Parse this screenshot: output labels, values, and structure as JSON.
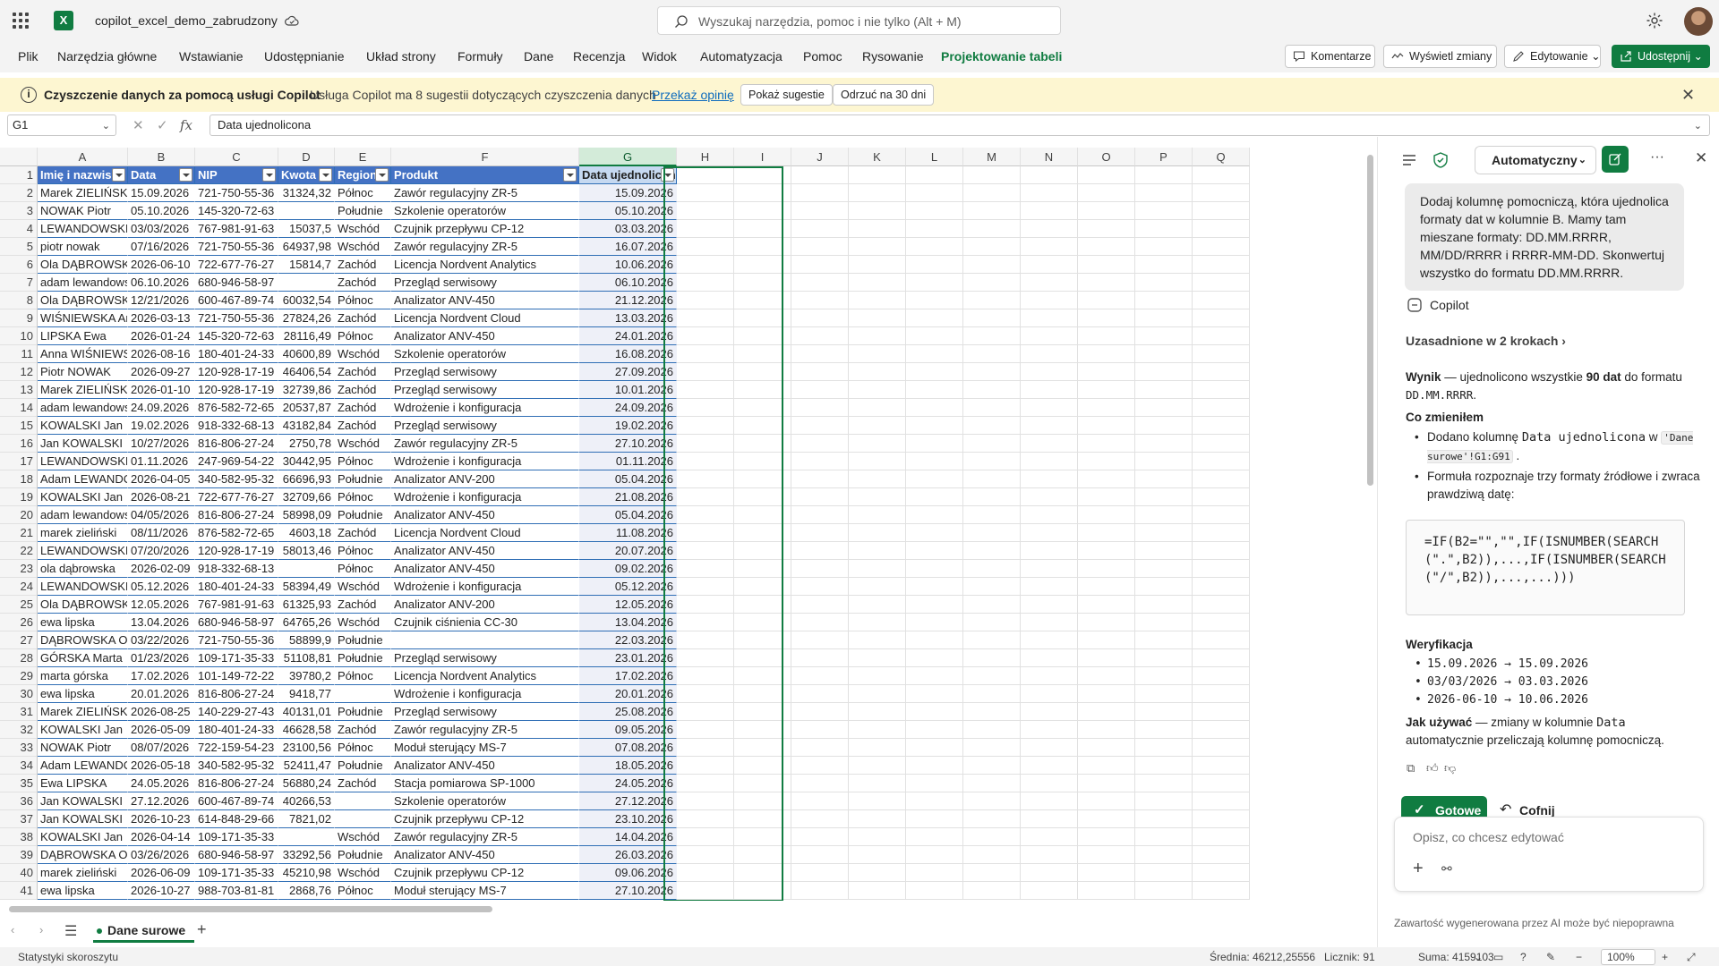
{
  "app": {
    "doc_title": "copilot_excel_demo_zabrudzony",
    "search_placeholder": "Wyszukaj narzędzia, pomoc i nie tylko (Alt + M)",
    "logo": "X"
  },
  "ribbon": {
    "tabs": [
      "Plik",
      "Narzędzia główne",
      "Wstawianie",
      "Udostępnianie",
      "Układ strony",
      "Formuły",
      "Dane",
      "Recenzja",
      "Widok",
      "Automatyzacja",
      "Pomoc",
      "Rysowanie",
      "Projektowanie tabeli"
    ],
    "active_tab": "Projektowanie tabeli",
    "comments": "Komentarze",
    "show_changes": "Wyświetl zmiany",
    "editing": "Edytowanie",
    "share": "Udostępnij"
  },
  "banner": {
    "title": "Czyszczenie danych za pomocą usługi Copilot",
    "text": "Usługa Copilot ma 8 sugestii dotyczących czyszczenia danych",
    "link": "Przekaż opinię",
    "show_btn": "Pokaż sugestie",
    "dismiss_btn": "Odrzuć na 30 dni"
  },
  "formula_bar": {
    "name_box": "G1",
    "fx": "fx",
    "value": "Data ujednolicona"
  },
  "grid": {
    "columns": [
      "A",
      "B",
      "C",
      "D",
      "E",
      "F",
      "G",
      "H",
      "I",
      "J",
      "K",
      "L",
      "M",
      "N",
      "O",
      "P",
      "Q"
    ],
    "headers": [
      "Imię i nazwisko",
      "Data",
      "NIP",
      "Kwota",
      "Region",
      "Produkt",
      "Data ujednolicona"
    ],
    "rows": [
      [
        "Marek ZIELIŃSKI",
        "15.09.2026",
        "721-750-55-36",
        "31324,32",
        "Północ",
        "Zawór regulacyjny ZR-5",
        "15.09.2026"
      ],
      [
        "NOWAK Piotr",
        "05.10.2026",
        "145-320-72-63",
        "",
        "Południe",
        "Szkolenie operatorów",
        "05.10.2026"
      ],
      [
        "LEWANDOWSKI Adam",
        "03/03/2026",
        "767-981-91-63",
        "15037,5",
        "Wschód",
        "Czujnik przepływu CP-12",
        "03.03.2026"
      ],
      [
        "piotr nowak",
        "07/16/2026",
        "721-750-55-36",
        "64937,98",
        "Wschód",
        "Zawór regulacyjny ZR-5",
        "16.07.2026"
      ],
      [
        "Ola DĄBROWSKA",
        "2026-06-10",
        "722-677-76-27",
        "15814,7",
        "Zachód",
        "Licencja Nordvent Analytics",
        "10.06.2026"
      ],
      [
        "adam lewandowski",
        "06.10.2026",
        "680-946-58-97",
        "",
        "Zachód",
        "Przegląd serwisowy",
        "06.10.2026"
      ],
      [
        "Ola DĄBROWSKA",
        "12/21/2026",
        "600-467-89-74",
        "60032,54",
        "Północ",
        "Analizator ANV-450",
        "21.12.2026"
      ],
      [
        "WIŚNIEWSKA Anna",
        "2026-03-13",
        "721-750-55-36",
        "27824,26",
        "Zachód",
        "Licencja Nordvent Cloud",
        "13.03.2026"
      ],
      [
        "LIPSKA Ewa",
        "2026-01-24",
        "145-320-72-63",
        "28116,49",
        "Północ",
        "Analizator ANV-450",
        "24.01.2026"
      ],
      [
        "Anna WIŚNIEWSKA",
        "2026-08-16",
        "180-401-24-33",
        "40600,89",
        "Wschód",
        "Szkolenie operatorów",
        "16.08.2026"
      ],
      [
        "Piotr NOWAK",
        "2026-09-27",
        "120-928-17-19",
        "46406,54",
        "Zachód",
        "Przegląd serwisowy",
        "27.09.2026"
      ],
      [
        "Marek ZIELIŃSKI",
        "2026-01-10",
        "120-928-17-19",
        "32739,86",
        "Zachód",
        "Przegląd serwisowy",
        "10.01.2026"
      ],
      [
        "adam lewandowski",
        "24.09.2026",
        "876-582-72-65",
        "20537,87",
        "Zachód",
        "Wdrożenie i konfiguracja",
        "24.09.2026"
      ],
      [
        "KOWALSKI Jan",
        "19.02.2026",
        "918-332-68-13",
        "43182,84",
        "Zachód",
        "Przegląd serwisowy",
        "19.02.2026"
      ],
      [
        "Jan KOWALSKI",
        "10/27/2026",
        "816-806-27-24",
        "2750,78",
        "Wschód",
        "Zawór regulacyjny ZR-5",
        "27.10.2026"
      ],
      [
        "LEWANDOWSKI Adam",
        "01.11.2026",
        "247-969-54-22",
        "30442,95",
        "Północ",
        "Wdrożenie i konfiguracja",
        "01.11.2026"
      ],
      [
        "Adam LEWANDOWSKI",
        "2026-04-05",
        "340-582-95-32",
        "66696,93",
        "Południe",
        "Analizator ANV-200",
        "05.04.2026"
      ],
      [
        "KOWALSKI Jan",
        "2026-08-21",
        "722-677-76-27",
        "32709,66",
        "Północ",
        "Wdrożenie i konfiguracja",
        "21.08.2026"
      ],
      [
        "adam lewandowski",
        "04/05/2026",
        "816-806-27-24",
        "58998,09",
        "Południe",
        "Analizator ANV-450",
        "05.04.2026"
      ],
      [
        "marek zieliński",
        "08/11/2026",
        "876-582-72-65",
        "4603,18",
        "Zachód",
        "Licencja Nordvent Cloud",
        "11.08.2026"
      ],
      [
        "LEWANDOWSKI Adam",
        "07/20/2026",
        "120-928-17-19",
        "58013,46",
        "Północ",
        "Analizator ANV-450",
        "20.07.2026"
      ],
      [
        "ola dąbrowska",
        "2026-02-09",
        "918-332-68-13",
        "",
        "Północ",
        "Analizator ANV-450",
        "09.02.2026"
      ],
      [
        "LEWANDOWSKI Adam",
        "05.12.2026",
        "180-401-24-33",
        "58394,49",
        "Wschód",
        "Wdrożenie i konfiguracja",
        "05.12.2026"
      ],
      [
        "Ola DĄBROWSKA",
        "12.05.2026",
        "767-981-91-63",
        "61325,93",
        "Zachód",
        "Analizator ANV-200",
        "12.05.2026"
      ],
      [
        "ewa lipska",
        "13.04.2026",
        "680-946-58-97",
        "64765,26",
        "Wschód",
        "Czujnik ciśnienia CC-30",
        "13.04.2026"
      ],
      [
        "DĄBROWSKA Ola",
        "03/22/2026",
        "721-750-55-36",
        "58899,9",
        "Południe",
        "",
        "22.03.2026"
      ],
      [
        "GÓRSKA Marta",
        "01/23/2026",
        "109-171-35-33",
        "51108,81",
        "Południe",
        "Przegląd serwisowy",
        "23.01.2026"
      ],
      [
        "marta górska",
        "17.02.2026",
        "101-149-72-22",
        "39780,2",
        "Północ",
        "Licencja Nordvent Analytics",
        "17.02.2026"
      ],
      [
        "ewa lipska",
        "20.01.2026",
        "816-806-27-24",
        "9418,77",
        "",
        "Wdrożenie i konfiguracja",
        "20.01.2026"
      ],
      [
        "Marek ZIELIŃSKI",
        "2026-08-25",
        "140-229-27-43",
        "40131,01",
        "Południe",
        "Przegląd serwisowy",
        "25.08.2026"
      ],
      [
        "KOWALSKI Jan",
        "2026-05-09",
        "180-401-24-33",
        "46628,58",
        "Zachód",
        "Zawór regulacyjny ZR-5",
        "09.05.2026"
      ],
      [
        "NOWAK Piotr",
        "08/07/2026",
        "722-159-54-23",
        "23100,56",
        "Północ",
        "Moduł sterujący MS-7",
        "07.08.2026"
      ],
      [
        "Adam LEWANDOWSKI",
        "2026-05-18",
        "340-582-95-32",
        "52411,47",
        "Południe",
        "Analizator ANV-450",
        "18.05.2026"
      ],
      [
        "Ewa LIPSKA",
        "24.05.2026",
        "816-806-27-24",
        "56880,24",
        "Zachód",
        "Stacja pomiarowa SP-1000",
        "24.05.2026"
      ],
      [
        "Jan KOWALSKI",
        "27.12.2026",
        "600-467-89-74",
        "40266,53",
        "",
        "Szkolenie operatorów",
        "27.12.2026"
      ],
      [
        "Jan KOWALSKI",
        "2026-10-23",
        "614-848-29-66",
        "7821,02",
        "",
        "Czujnik przepływu CP-12",
        "23.10.2026"
      ],
      [
        "KOWALSKI Jan",
        "2026-04-14",
        "109-171-35-33",
        "",
        "Wschód",
        "Zawór regulacyjny ZR-5",
        "14.04.2026"
      ],
      [
        "DĄBROWSKA Ola",
        "03/26/2026",
        "680-946-58-97",
        "33292,56",
        "Południe",
        "Analizator ANV-450",
        "26.03.2026"
      ],
      [
        "marek zieliński",
        "2026-06-09",
        "109-171-35-33",
        "45210,98",
        "Wschód",
        "Czujnik przepływu CP-12",
        "09.06.2026"
      ],
      [
        "ewa lipska",
        "2026-10-27",
        "988-703-81-81",
        "2868,76",
        "Północ",
        "Moduł sterujący MS-7",
        "27.10.2026"
      ]
    ]
  },
  "sheet_bar": {
    "active_sheet": "Dane surowe"
  },
  "status_bar": {
    "left": "Statystyki skoroszytu",
    "average": "Średnia: 46212,25556",
    "count": "Licznik: 91",
    "sum": "Suma: 4159103",
    "zoom": "100%"
  },
  "copilot": {
    "mode": "Automatyczny",
    "user_message": "Dodaj kolumnę pomocniczą, która ujednolica formaty dat w kolumnie B. Mamy tam mieszane formaty: DD.MM.RRRR, MM/DD/RRRR i RRRR-MM-DD. Skonwertuj wszystko do formatu DD.MM.RRRR.",
    "name": "Copilot",
    "grounded": "Uzasadnione w 2 krokach",
    "result_label": "Wynik",
    "result_a": " — ujednolicono wszystkie ",
    "result_b": "90 dat",
    "result_c": " do formatu ",
    "result_fmt": "DD.MM.RRRR",
    "result_end": ".",
    "changed_title": "Co zmieniłem",
    "bullet1_a": "Dodano kolumnę ",
    "bullet1_b": "Data ujednolicona",
    "bullet1_c": " w ",
    "bullet1_d": "'Dane surowe'!G1:G91",
    "bullet1_e": " .",
    "bullet2": "Formuła rozpoznaje trzy formaty źródłowe i zwraca prawdziwą datę:",
    "formula": "=IF(B2=\"\",\"\",IF(ISNUMBER(SEARCH(\".\",B2)),...,IF(ISNUMBER(SEARCH(\"/\",B2)),...,...)))",
    "verify_title": "Weryfikacja",
    "verify": [
      "15.09.2026 → 15.09.2026",
      "03/03/2026 → 03.03.2026",
      "2026-06-10 → 10.06.2026"
    ],
    "howto_label": "Jak używać",
    "howto_a": " — zmiany w kolumnie ",
    "howto_b": "Data",
    "howto_c": " automatycznie przeliczają kolumnę pomocniczą.",
    "done": "Gotowe",
    "undo": "Cofnij",
    "compose_placeholder": "Opisz, co chcesz edytować",
    "disclaimer": "Zawartość wygenerowana przez AI może być niepoprawna"
  },
  "colors": {
    "excel_green": "#107c41",
    "table_header": "#4472c4",
    "banner_bg": "#fdf6d1",
    "link": "#0f6cbd"
  }
}
